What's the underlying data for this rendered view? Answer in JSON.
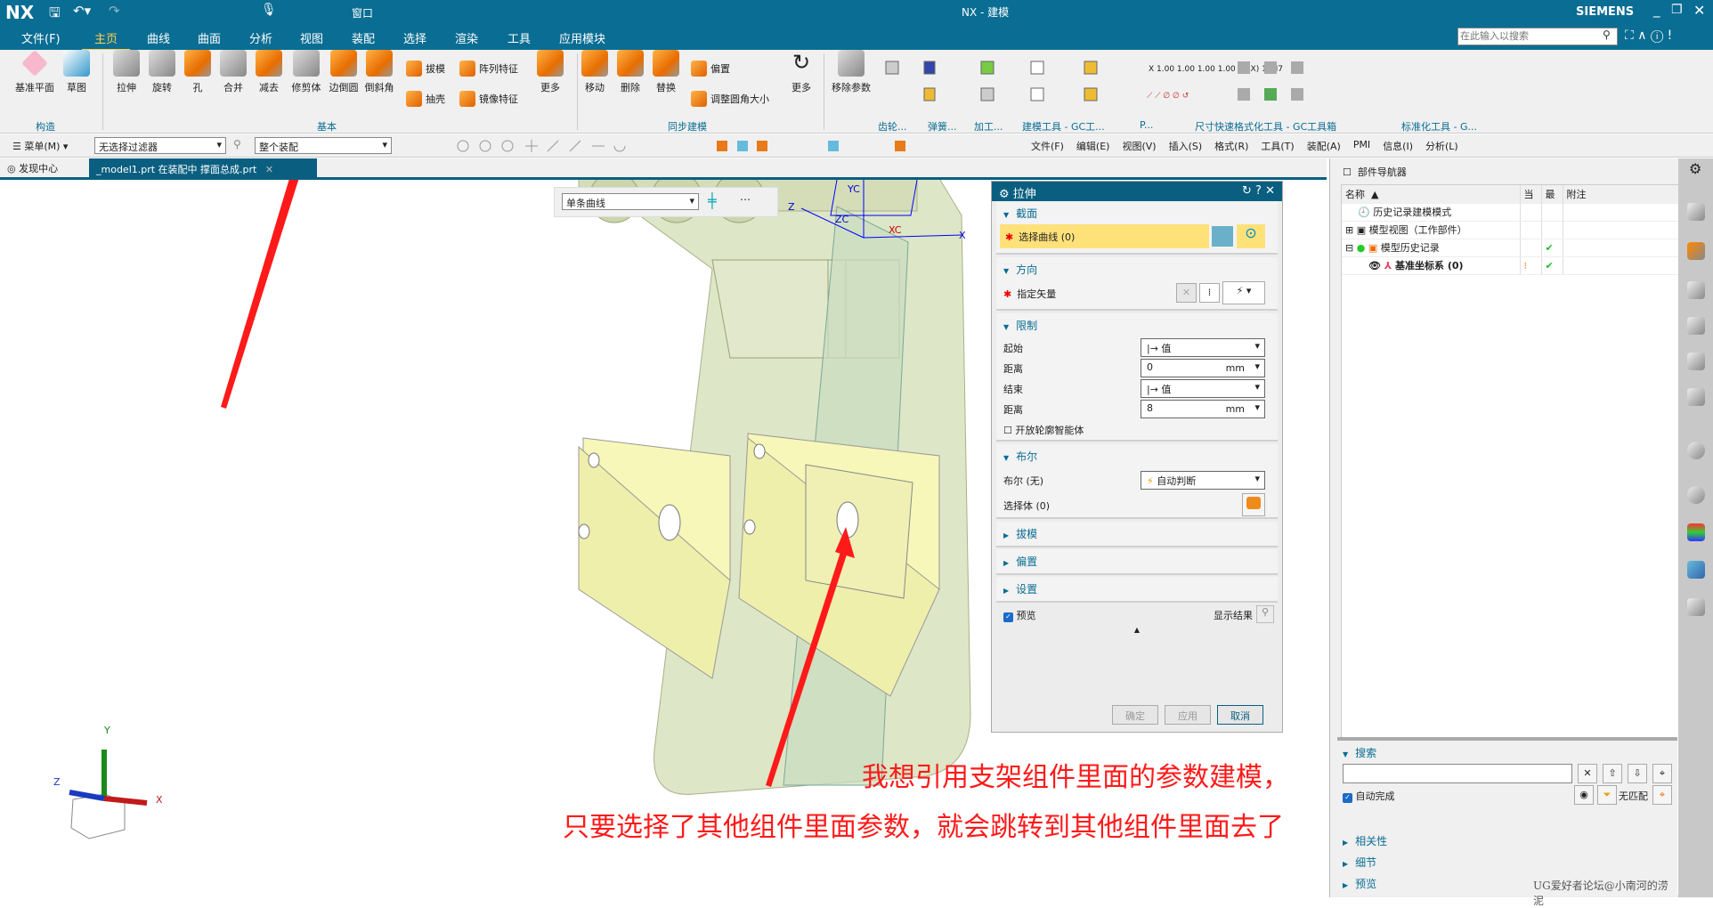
{
  "app": {
    "logo": "NX",
    "title": "NX - 建模",
    "brand": "SIEMENS",
    "window_menu": "窗口",
    "search_placeholder": "在此输入以搜索"
  },
  "menu_tabs": [
    "文件(F)",
    "主页",
    "曲线",
    "曲面",
    "分析",
    "视图",
    "装配",
    "选择",
    "渲染",
    "工具",
    "应用模块"
  ],
  "active_tab": "主页",
  "ribbon": {
    "construct": {
      "label": "构造",
      "buttons": [
        "基准平面",
        "草图"
      ]
    },
    "basic": {
      "label": "基本",
      "buttons": [
        "拉伸",
        "旋转",
        "孔",
        "合并",
        "减去",
        "修剪体",
        "边倒圆",
        "倒斜角"
      ],
      "small": [
        "拔模",
        "阵列特征",
        "抽壳",
        "镜像特征"
      ],
      "more": "更多"
    },
    "sync": {
      "label": "同步建模",
      "buttons": [
        "移动",
        "删除",
        "替换"
      ],
      "small": [
        "偏置",
        "调整圆角大小"
      ],
      "more": "更多"
    },
    "remove_params": "移除参数",
    "groups": [
      "齿轮...",
      "弹簧...",
      "加工...",
      "建模工具 - GC工...",
      "P...",
      "尺寸快速格式化工具 - GC工具箱",
      "标准化工具 - G..."
    ]
  },
  "toolbar": {
    "menu": "菜单(M)",
    "filter": "无选择过滤器",
    "scope": "整个装配",
    "menus": [
      "文件(F)",
      "编辑(E)",
      "视图(V)",
      "插入(S)",
      "格式(R)",
      "工具(T)",
      "装配(A)",
      "PMI",
      "信息(I)",
      "分析(L)"
    ]
  },
  "doc_tabs": [
    {
      "label": "发现中心"
    },
    {
      "label": "_model1.prt 在装配中 撑面总成.prt",
      "active": true
    }
  ],
  "curve_rule": "单条曲线",
  "axes": {
    "x": "X",
    "y": "Y",
    "z": "Z",
    "xc": "XC",
    "yc": "YC",
    "zc": "ZC"
  },
  "dialog": {
    "title": "拉伸",
    "section": {
      "title": "截面",
      "select": "选择曲线 (0)"
    },
    "direction": {
      "title": "方向",
      "vector": "指定矢量"
    },
    "limits": {
      "title": "限制",
      "start_label": "起始",
      "start_value": "值",
      "dist1_label": "距离",
      "dist1": "0",
      "end_label": "结束",
      "end_value": "值",
      "dist2_label": "距离",
      "dist2": "8",
      "unit": "mm",
      "open_profile": "开放轮廓智能体",
      "open_profile_checked": false
    },
    "boolean": {
      "title": "布尔",
      "label": "布尔 (无)",
      "value": "自动判断",
      "select_body": "选择体 (0)"
    },
    "collapsed": [
      "拔模",
      "偏置",
      "设置"
    ],
    "preview": "预览",
    "preview_checked": true,
    "show_result": "显示结果",
    "ok": "确定",
    "apply": "应用",
    "cancel": "取消"
  },
  "navigator": {
    "title": "部件导航器",
    "columns": [
      "名称",
      "当",
      "最",
      "附注"
    ],
    "rows": [
      {
        "name": "历史记录建模模式",
        "check": false
      },
      {
        "name": "模型视图（工作部件）",
        "check": false
      },
      {
        "name": "模型历史记录",
        "check": true
      },
      {
        "name": "基准坐标系 (0)",
        "check": true
      }
    ],
    "search": {
      "title": "搜索",
      "value": "",
      "autocomplete": "自动完成",
      "autocomplete_checked": true,
      "no_match": "无匹配"
    },
    "sections": [
      "相关性",
      "细节",
      "预览"
    ]
  },
  "annotations": {
    "line1": "我想引用支架组件里面的参数建模，",
    "line2": "只要选择了其他组件里面参数，就会跳转到其他组件里面去了"
  },
  "watermark": "UG爱好者论坛@小南河的涝泥",
  "colors": {
    "accent": "#0a6d93",
    "highlight": "#ffe17a",
    "annotation": "#ff1a1a",
    "check": "#22bb33"
  }
}
